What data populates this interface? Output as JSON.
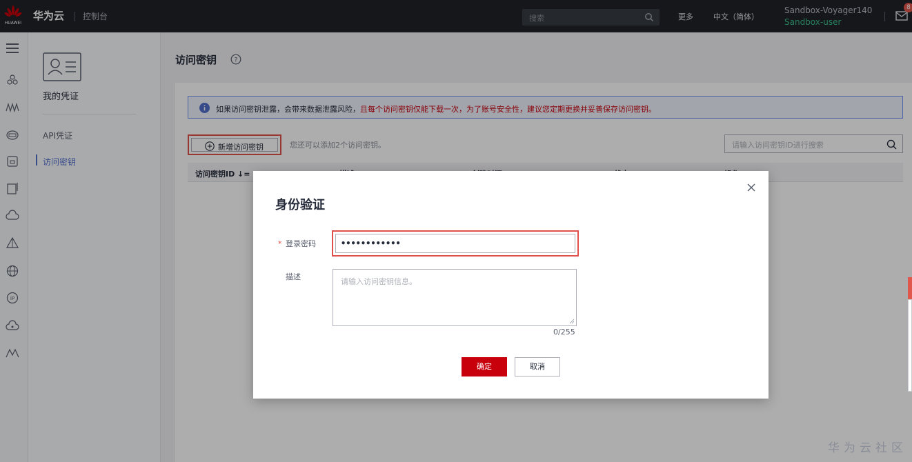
{
  "topbar": {
    "logo_text": "HUAWEI",
    "brand": "华为云",
    "console": "控制台",
    "search_placeholder": "搜索",
    "more": "更多",
    "language": "中文（简体）",
    "account_name": "Sandbox-Voyager140",
    "account_user": "Sandbox-user",
    "badge": "8"
  },
  "rail": {
    "icons": [
      "menu-icon",
      "people-icon",
      "waves-icon",
      "cloud-disk-icon",
      "box-icon",
      "document-icon",
      "cloud-icon",
      "pyramid-icon",
      "globe-icon",
      "ip-icon",
      "cloud-network-icon",
      "mountain-icon"
    ]
  },
  "subnav": {
    "title": "我的凭证",
    "items": [
      {
        "label": "API凭证"
      },
      {
        "label": "访问密钥"
      }
    ]
  },
  "page": {
    "title": "访问密钥",
    "notice_normal": "如果访问密钥泄露，会带来数据泄露风险，",
    "notice_red": "且每个访问密钥仅能下载一次，为了账号安全性，建议您定期更换并妥善保存访问密钥。",
    "add_button": "新增访问密钥",
    "add_hint": "您还可以添加2个访问密钥。",
    "search_placeholder": "请输入访问密钥ID进行搜索",
    "table_headers": [
      "访问密钥ID ↓=",
      "描述 ↓=",
      "创建时间 ↓=",
      "状态 ↓=",
      "操作"
    ]
  },
  "dialog": {
    "title": "身份验证",
    "required_mark": "*",
    "password_label": "登录密码",
    "password_value": "••••••••••••",
    "description_label": "描述",
    "description_placeholder": "请输入访问密钥信息。",
    "counter": "0/255",
    "confirm": "确定",
    "cancel": "取消"
  },
  "footer": {
    "community": "华为云社区"
  },
  "colors": {
    "topbar": "#1f2329",
    "accent_red": "#c7000b",
    "highlight": "#e0504a",
    "link_blue": "#526ecc"
  }
}
